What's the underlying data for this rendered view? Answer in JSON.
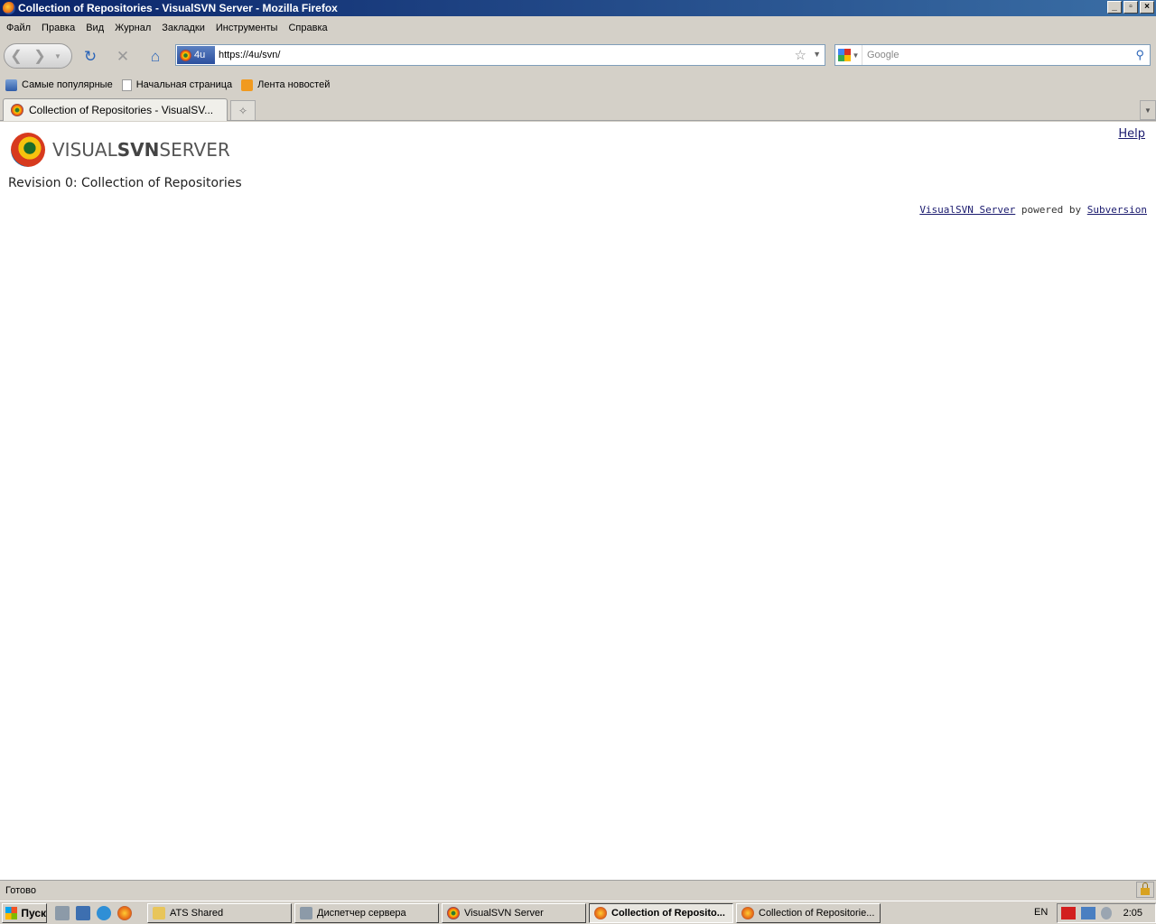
{
  "window": {
    "title": "Collection of Repositories - VisualSVN Server - Mozilla Firefox",
    "controls": [
      "_",
      "▫",
      "×"
    ]
  },
  "menu": [
    "Файл",
    "Правка",
    "Вид",
    "Журнал",
    "Закладки",
    "Инструменты",
    "Справка"
  ],
  "navbar": {
    "site_id": "4u",
    "url": "https://4u/svn/",
    "search_placeholder": "Google"
  },
  "bookmarks": [
    "Самые популярные",
    "Начальная страница",
    "Лента новостей"
  ],
  "tabs": [
    {
      "label": "Collection of Repositories - VisualSV..."
    }
  ],
  "page": {
    "logo_text_1": "VISUAL",
    "logo_text_2": "SVN",
    "logo_text_3": "SERVER",
    "help_link": "Help",
    "revision_title": "Revision 0: Collection of Repositories",
    "footer": {
      "link1": "VisualSVN Server",
      "middle": " powered by ",
      "link2": "Subversion"
    }
  },
  "status": {
    "text": "Готово"
  },
  "taskbar": {
    "start_label": "Пуск",
    "buttons": [
      {
        "label": "ATS Shared"
      },
      {
        "label": "Диспетчер сервера"
      },
      {
        "label": "VisualSVN Server"
      },
      {
        "label": "Collection of Reposito..."
      },
      {
        "label": "Collection of Repositorie..."
      }
    ],
    "language": "EN",
    "clock": "2:05"
  },
  "colors": {
    "title_bar": "#0a246a",
    "link": "#1a1a6e",
    "chrome": "#d4d0c8"
  }
}
